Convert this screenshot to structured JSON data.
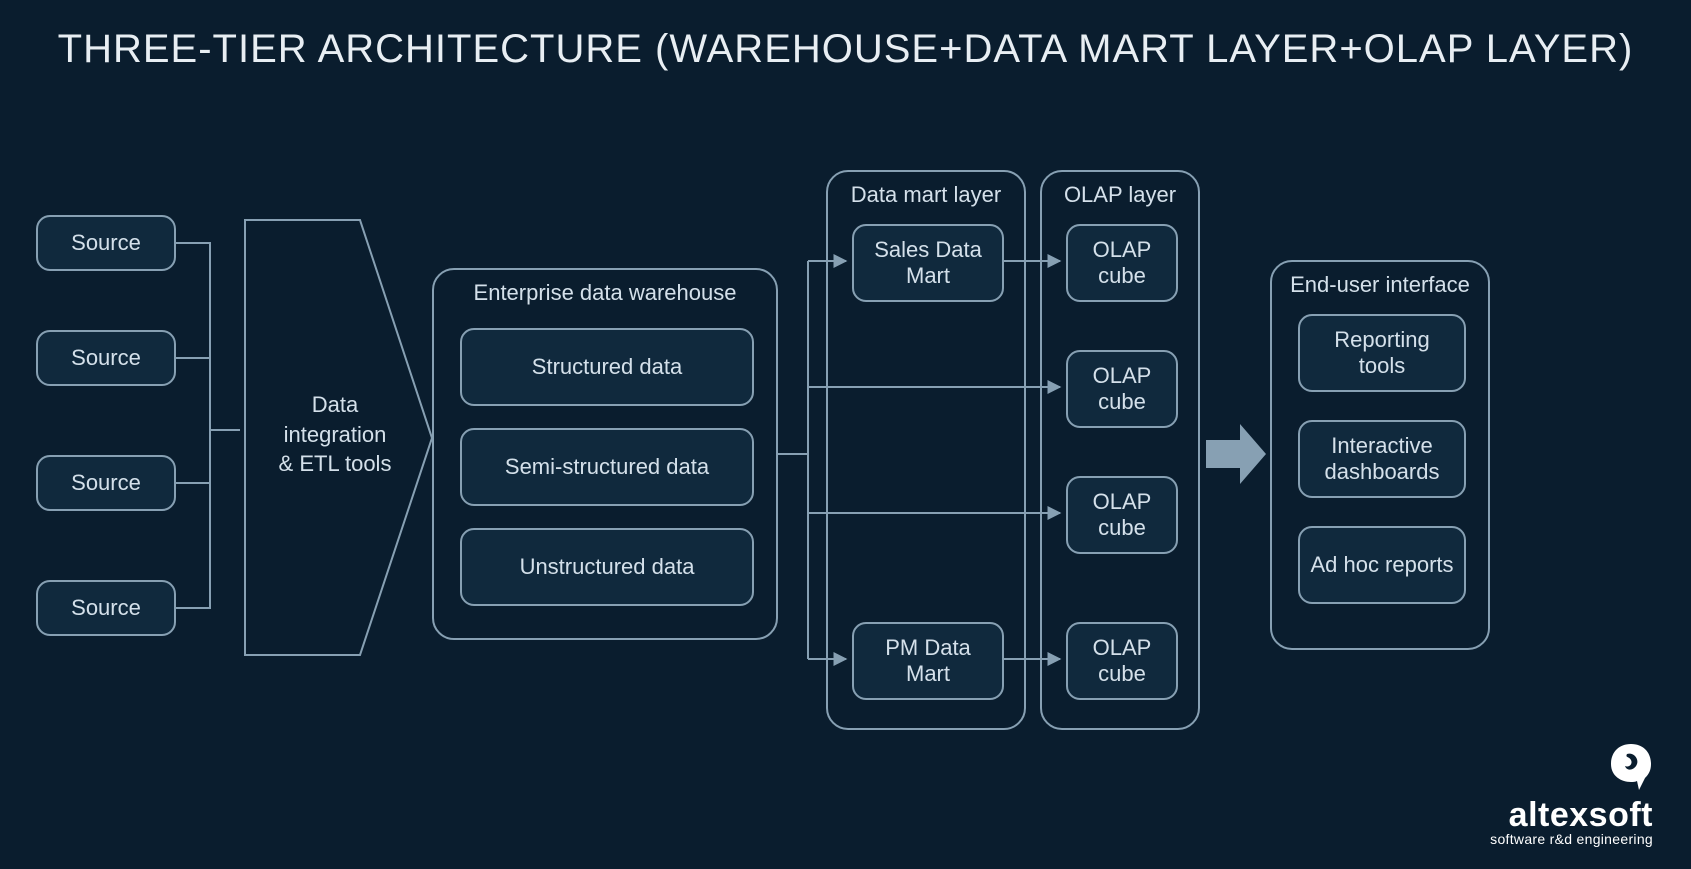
{
  "title": "THREE-TIER ARCHITECTURE (WAREHOUSE+DATA MART LAYER+OLAP LAYER)",
  "sources": [
    "Source",
    "Source",
    "Source",
    "Source"
  ],
  "etl_label": "Data\nintegration\n& ETL tools",
  "warehouse": {
    "label": "Enterprise data warehouse",
    "items": [
      "Structured data",
      "Semi-structured data",
      "Unstructured data"
    ]
  },
  "data_mart": {
    "label": "Data mart layer",
    "items": [
      "Sales Data Mart",
      "PM Data Mart"
    ]
  },
  "olap": {
    "label": "OLAP layer",
    "items": [
      "OLAP cube",
      "OLAP cube",
      "OLAP cube",
      "OLAP cube"
    ]
  },
  "end_user": {
    "label": "End-user interface",
    "items": [
      "Reporting tools",
      "Interactive dashboards",
      "Ad hoc reports"
    ]
  },
  "logo": {
    "brand": "altexsoft",
    "tagline": "software r&d engineering"
  }
}
